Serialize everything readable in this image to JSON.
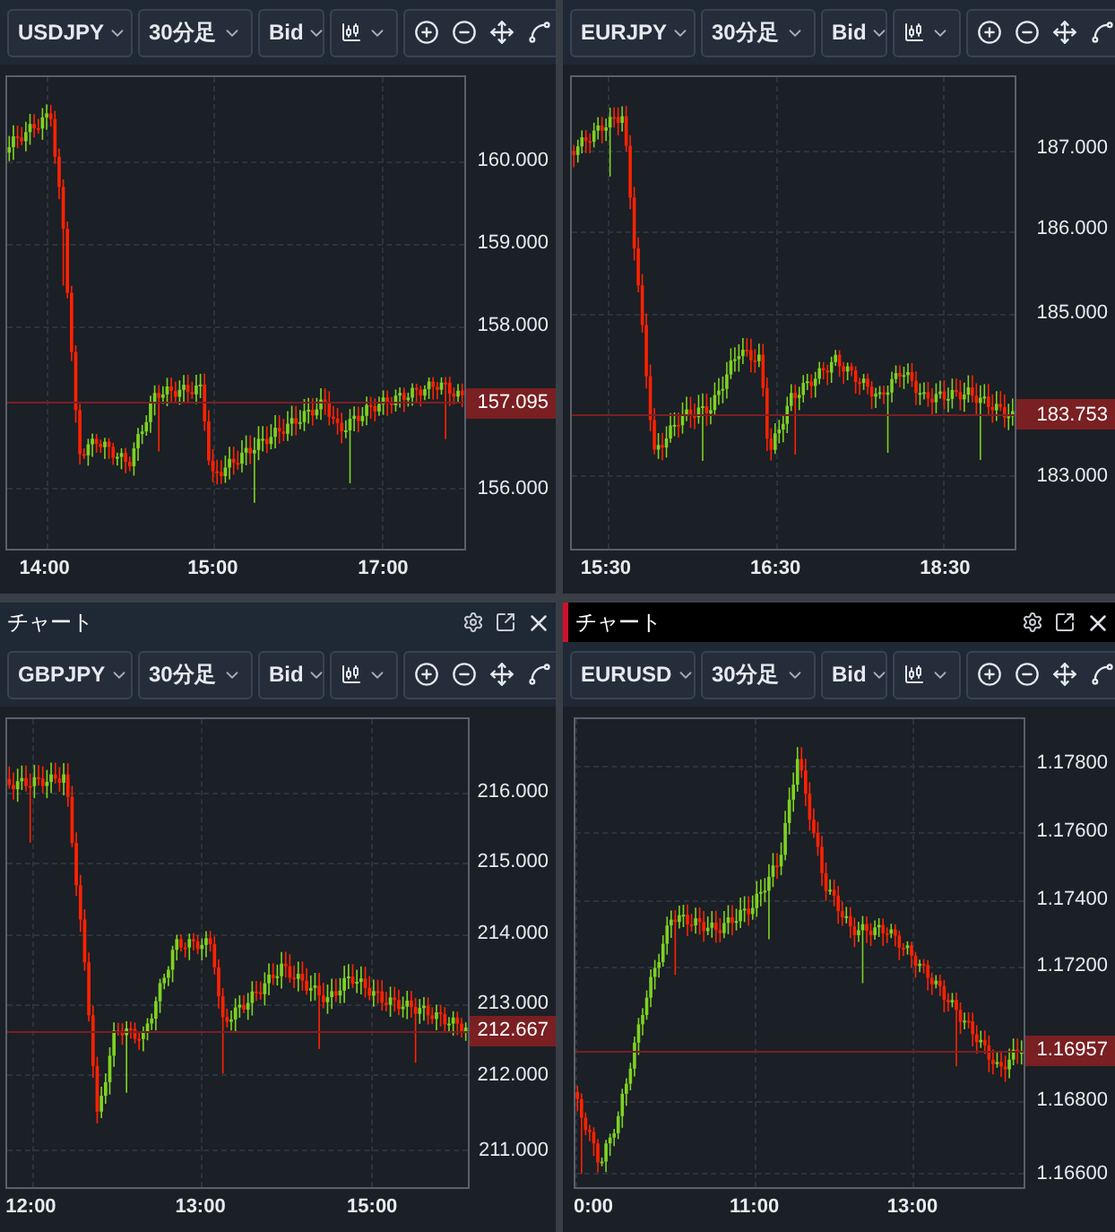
{
  "panels": [
    {
      "toolbar": {
        "symbol": "USDJPY",
        "timeframe": "30分足",
        "price_type": "Bid"
      },
      "y_axis": [
        "160.000",
        "159.000",
        "158.000",
        "156.000"
      ],
      "current_price": "157.095",
      "x_axis": [
        "14:00",
        "15:00",
        "17:00"
      ]
    },
    {
      "toolbar": {
        "symbol": "EURJPY",
        "timeframe": "30分足",
        "price_type": "Bid"
      },
      "y_axis": [
        "187.000",
        "186.000",
        "185.000",
        "183.000"
      ],
      "current_price": "183.753",
      "x_axis": [
        "15:30",
        "16:30",
        "18:30"
      ]
    },
    {
      "header": {
        "title": "チャート",
        "selected": false
      },
      "toolbar": {
        "symbol": "GBPJPY",
        "timeframe": "30分足",
        "price_type": "Bid"
      },
      "y_axis": [
        "216.000",
        "215.000",
        "214.000",
        "213.000",
        "212.000",
        "211.000"
      ],
      "current_price": "212.667",
      "x_axis": [
        "12:00",
        "13:00",
        "15:00"
      ]
    },
    {
      "header": {
        "title": "チャート",
        "selected": true
      },
      "toolbar": {
        "symbol": "EURUSD",
        "timeframe": "30分足",
        "price_type": "Bid"
      },
      "y_axis": [
        "1.17800",
        "1.17600",
        "1.17400",
        "1.17200",
        "1.16800",
        "1.16600"
      ],
      "current_price": "1.16957",
      "x_axis": [
        "0:00",
        "11:00",
        "13:00"
      ]
    }
  ]
}
